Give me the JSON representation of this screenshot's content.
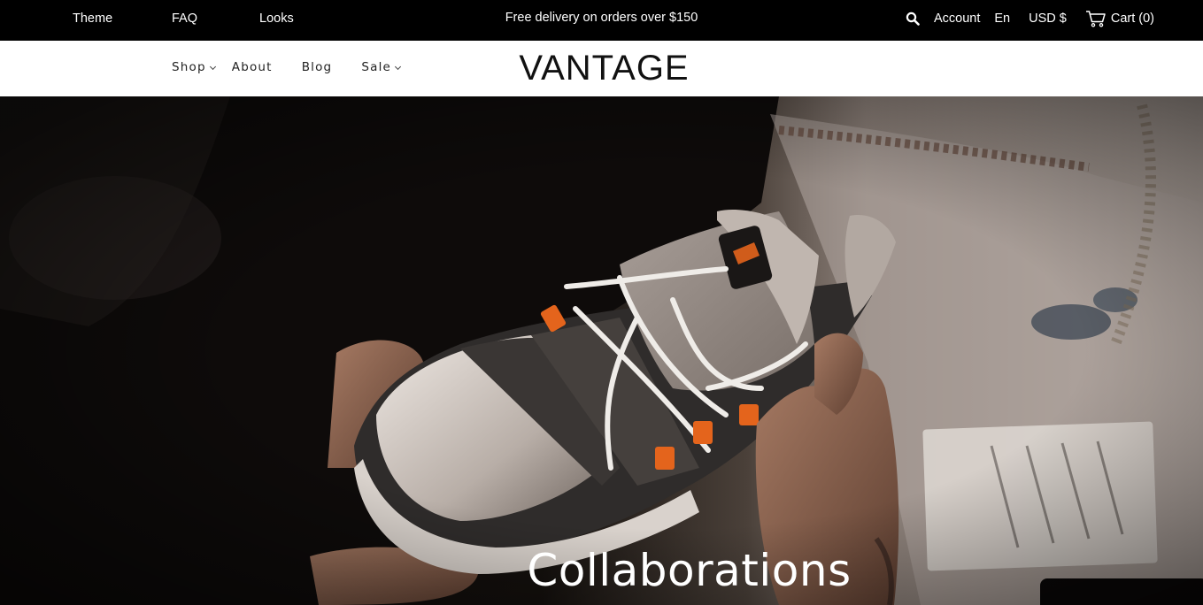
{
  "topbar": {
    "links": [
      "Theme",
      "FAQ",
      "Looks"
    ],
    "promo": "Free delivery on orders over $150",
    "account": "Account",
    "language": "En",
    "currency": "USD $",
    "cart": "Cart (0)"
  },
  "header": {
    "logo": "VANTAGE",
    "nav": [
      {
        "label": "Shop",
        "has_dropdown": true
      },
      {
        "label": "About",
        "has_dropdown": false
      },
      {
        "label": "Blog",
        "has_dropdown": false
      },
      {
        "label": "Sale",
        "has_dropdown": true
      }
    ]
  },
  "hero": {
    "title": "Collaborations"
  },
  "colors": {
    "topbar_bg": "#000000",
    "header_bg": "#ffffff",
    "text_dark": "#222222",
    "accent_orange": "#e4641c"
  }
}
